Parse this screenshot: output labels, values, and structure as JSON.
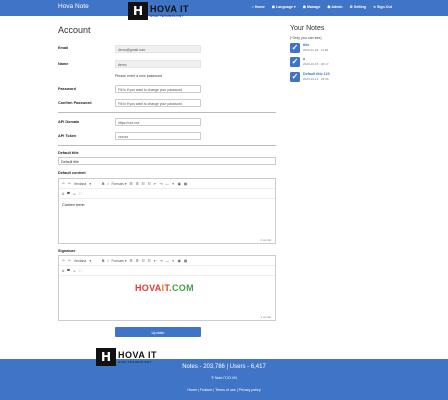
{
  "navbar": {
    "brand": "Hova Note",
    "logo_name": "HOVA IT",
    "logo_sub": "HIGH TECHNOLOGY",
    "links": [
      "⌂ Home",
      "☗ Language ▾",
      "☗ Manage",
      "☗ Admin",
      "⚙ Setting",
      "➜ Sign Out"
    ]
  },
  "main": {
    "title": "Account",
    "email_label": "Email",
    "email_value": "demo@gmail.com",
    "name_label": "Name",
    "name_value": "demo",
    "password_hint": "Please enter a new password",
    "password_label": "Password",
    "password_placeholder": "Fill in if you want to change your password",
    "confirm_label": "Confirm Password",
    "confirm_placeholder": "Fill in if you want to change your password",
    "api_domain_label": "API Domain",
    "api_domain_placeholder": "https://xxx.xxx",
    "api_token_label": "API Token",
    "api_token_placeholder": "xxxxxx",
    "default_title_label": "Default title",
    "default_title_value": "Default title",
    "default_content_label": "Default content",
    "default_content_text": "Conten here:",
    "default_content_count": "2 words",
    "signature_label": "Signature",
    "signature_brand_a": "HOVA",
    "signature_brand_b": "I",
    "signature_brand_c": "T",
    "signature_brand_d": ".COM",
    "signature_count": "1 words",
    "update_label": "Update"
  },
  "toolbar": {
    "font": "Verdana",
    "formats": "Formats ▾"
  },
  "sidebar": {
    "title": "Your Notes",
    "subtitle": "(*Only you can see)",
    "notes": [
      {
        "title": "title",
        "time": "2023-11-18 · 11:48"
      },
      {
        "title": "a",
        "time": "2023-10-15 · 00:17"
      },
      {
        "title": "Default title 123",
        "time": "2023-10-13 · 22:06"
      }
    ]
  },
  "footer": {
    "stats": "Notes - 203,786 | Users - 6,417",
    "copyright": "© Note.IT.ID.VN",
    "links": "Home | Feature | Terms of use | Privacy policy"
  },
  "colors": {
    "primary": "#3f74c7",
    "brand_red": "#e53935",
    "brand_orange": "#f57c00",
    "brand_green": "#43a047"
  }
}
